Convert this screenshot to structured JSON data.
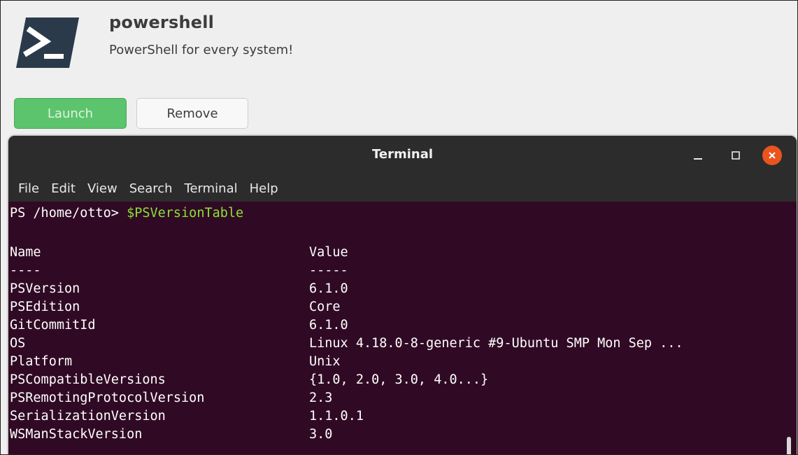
{
  "app": {
    "icon": "powershell-icon",
    "title": "powershell",
    "subtitle": "PowerShell for every system!",
    "launch_label": "Launch",
    "remove_label": "Remove"
  },
  "terminal": {
    "title": "Terminal",
    "controls": [
      "minimize-icon",
      "maximize-icon",
      "close-icon"
    ],
    "menu": [
      "File",
      "Edit",
      "View",
      "Search",
      "Terminal",
      "Help"
    ],
    "prompt": "PS /home/otto> ",
    "command": "$PSVersionTable",
    "header": {
      "name": "Name",
      "value": "Value"
    },
    "divider": {
      "name": "----",
      "value": "-----"
    },
    "rows": [
      {
        "name": "PSVersion",
        "value": "6.1.0"
      },
      {
        "name": "PSEdition",
        "value": "Core"
      },
      {
        "name": "GitCommitId",
        "value": "6.1.0"
      },
      {
        "name": "OS",
        "value": "Linux 4.18.0-8-generic #9-Ubuntu SMP Mon Sep ..."
      },
      {
        "name": "Platform",
        "value": "Unix"
      },
      {
        "name": "PSCompatibleVersions",
        "value": "{1.0, 2.0, 3.0, 4.0...}"
      },
      {
        "name": "PSRemotingProtocolVersion",
        "value": "2.3"
      },
      {
        "name": "SerializationVersion",
        "value": "1.1.0.1"
      },
      {
        "name": "WSManStackVersion",
        "value": "3.0"
      }
    ]
  },
  "colors": {
    "terminal_bg": "#300a24",
    "prompt_command": "#8ae234",
    "launch_green": "#5cc46c",
    "close_orange": "#e9541f"
  }
}
